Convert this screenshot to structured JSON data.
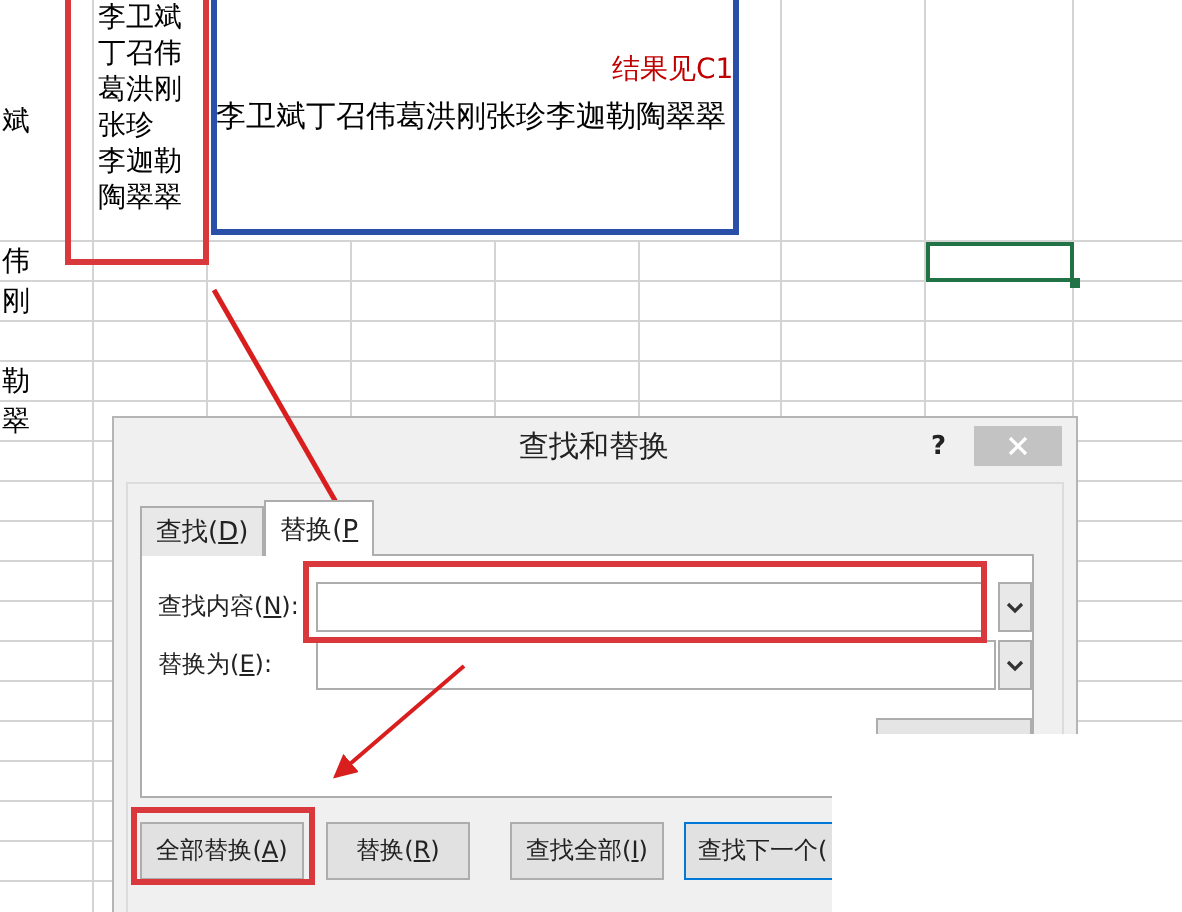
{
  "sheet": {
    "rows": [
      {
        "column_a": "斌",
        "column_b_lines": [
          "李卫斌",
          "丁召伟",
          "葛洪刚",
          "张珍",
          "李迦勒",
          "陶翠翠"
        ],
        "column_c": "李卫斌丁召伟葛洪刚张珍李迦勒陶翠翠",
        "column_e": "结果见C1"
      },
      {
        "column_a": "伟",
        "cell_h_selected": true
      },
      {
        "column_a": "刚"
      },
      {},
      {
        "column_a": "勒"
      },
      {
        "column_a": "翠"
      }
    ]
  },
  "dialog": {
    "title": "查找和替换",
    "help": "?",
    "tabs": [
      {
        "prefix": "查找(",
        "key": "D",
        "suffix": ")",
        "selected": false
      },
      {
        "prefix": "替换(",
        "key": "P",
        "selected": true
      }
    ],
    "fields": [
      {
        "prefix": "查找内容(",
        "key": "N",
        "suffix": "):"
      },
      {
        "prefix": "替换为(",
        "key": "E",
        "suffix": "):"
      }
    ],
    "buttons": [
      {
        "prefix": "全部替换(",
        "key": "A",
        "suffix": ")",
        "default": false
      },
      {
        "prefix": "替换(",
        "key": "R",
        "suffix": ")",
        "default": false
      },
      {
        "prefix": "查找全部(",
        "key": "I",
        "suffix": ")",
        "default": false
      },
      {
        "prefix": "查找下一个(",
        "default": true
      }
    ]
  }
}
